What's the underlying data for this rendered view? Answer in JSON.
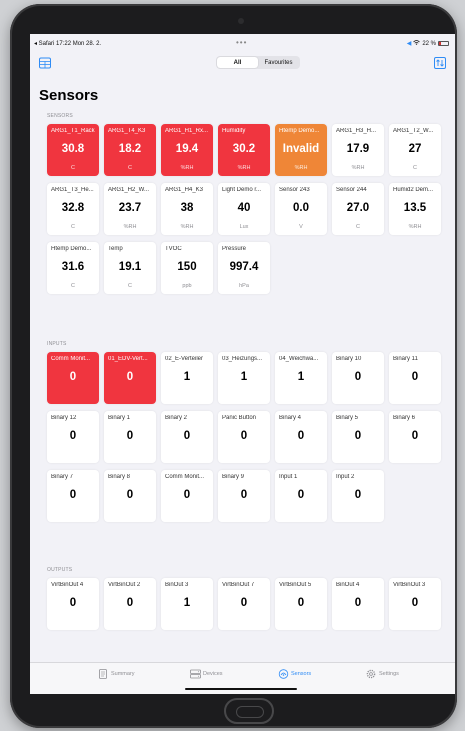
{
  "statusbar": {
    "carrier": "◂ Safari",
    "time": "17:22",
    "date": "Mon 28. 2.",
    "signal": "◀",
    "battery_percent": "22 %",
    "battery_level": 0.22,
    "battery_color": "#d33333"
  },
  "navbar": {
    "segments": [
      {
        "label": "All",
        "active": true
      },
      {
        "label": "Favourites",
        "active": false
      }
    ],
    "left_icon": "grid-icon",
    "right_icon": "sort-icon"
  },
  "page": {
    "title": "Sensors"
  },
  "colors": {
    "alarm": "#f0353f",
    "warning": "#ef8637",
    "accent": "#2f8cf5"
  },
  "sections": {
    "sensors": {
      "label": "SENSORS",
      "tiles": [
        {
          "name": "ARG1_T1_Rack",
          "value": "30.8",
          "unit": "C",
          "state": "red"
        },
        {
          "name": "ARG1_T4_K3",
          "value": "18.2",
          "unit": "C",
          "state": "red"
        },
        {
          "name": "ARG1_H1_Rx...",
          "value": "19.4",
          "unit": "%RH",
          "state": "red"
        },
        {
          "name": "Humidity",
          "value": "30.2",
          "unit": "%RH",
          "state": "red"
        },
        {
          "name": "Htemp Demo...",
          "value": "Invalid",
          "unit": "%RH",
          "state": "orange"
        },
        {
          "name": "ARG1_H3_H...",
          "value": "17.9",
          "unit": "%RH",
          "state": "normal"
        },
        {
          "name": "ARG1_T2_W...",
          "value": "27",
          "unit": "C",
          "state": "normal"
        },
        {
          "name": "ARG1_T3_He...",
          "value": "32.8",
          "unit": "C",
          "state": "normal"
        },
        {
          "name": "ARG1_H2_W...",
          "value": "23.7",
          "unit": "%RH",
          "state": "normal"
        },
        {
          "name": "ARG1_H4_K3",
          "value": "38",
          "unit": "%RH",
          "state": "normal"
        },
        {
          "name": "Light Demo r...",
          "value": "40",
          "unit": "Lux",
          "state": "normal"
        },
        {
          "name": "Sensor 243",
          "value": "0.0",
          "unit": "V",
          "state": "normal"
        },
        {
          "name": "Sensor 244",
          "value": "27.0",
          "unit": "C",
          "state": "normal"
        },
        {
          "name": "Humid2 Dem...",
          "value": "13.5",
          "unit": "%RH",
          "state": "normal"
        },
        {
          "name": "Htemp Demo...",
          "value": "31.6",
          "unit": "C",
          "state": "normal"
        },
        {
          "name": "Temp",
          "value": "19.1",
          "unit": "C",
          "state": "normal"
        },
        {
          "name": "TVOC",
          "value": "150",
          "unit": "ppb",
          "state": "normal"
        },
        {
          "name": "Pressure",
          "value": "997.4",
          "unit": "hPa",
          "state": "normal"
        }
      ]
    },
    "inputs": {
      "label": "INPUTS",
      "tiles": [
        {
          "name": "Comm Monit...",
          "value": "0",
          "unit": "",
          "state": "red"
        },
        {
          "name": "01_EDV-Vert...",
          "value": "0",
          "unit": "",
          "state": "red"
        },
        {
          "name": "02_E-Verteiler",
          "value": "1",
          "unit": "",
          "state": "normal"
        },
        {
          "name": "03_Heizungs...",
          "value": "1",
          "unit": "",
          "state": "normal"
        },
        {
          "name": "04_Weichwa...",
          "value": "1",
          "unit": "",
          "state": "normal"
        },
        {
          "name": "Binary 10",
          "value": "0",
          "unit": "",
          "state": "normal"
        },
        {
          "name": "Binary 11",
          "value": "0",
          "unit": "",
          "state": "normal"
        },
        {
          "name": "Binary 12",
          "value": "0",
          "unit": "",
          "state": "normal"
        },
        {
          "name": "Binary 1",
          "value": "0",
          "unit": "",
          "state": "normal"
        },
        {
          "name": "Binary 2",
          "value": "0",
          "unit": "",
          "state": "normal"
        },
        {
          "name": "Panic Button",
          "value": "0",
          "unit": "",
          "state": "normal"
        },
        {
          "name": "Binary 4",
          "value": "0",
          "unit": "",
          "state": "normal"
        },
        {
          "name": "Binary 5",
          "value": "0",
          "unit": "",
          "state": "normal"
        },
        {
          "name": "Binary 6",
          "value": "0",
          "unit": "",
          "state": "normal"
        },
        {
          "name": "Binary 7",
          "value": "0",
          "unit": "",
          "state": "normal"
        },
        {
          "name": "Binary 8",
          "value": "0",
          "unit": "",
          "state": "normal"
        },
        {
          "name": "Comm Monit...",
          "value": "0",
          "unit": "",
          "state": "normal"
        },
        {
          "name": "Binary 9",
          "value": "0",
          "unit": "",
          "state": "normal"
        },
        {
          "name": "Input 1",
          "value": "0",
          "unit": "",
          "state": "normal"
        },
        {
          "name": "Input 2",
          "value": "0",
          "unit": "",
          "state": "normal"
        }
      ]
    },
    "outputs": {
      "label": "OUTPUTS",
      "tiles": [
        {
          "name": "VirtBinOut 4",
          "value": "0",
          "unit": "",
          "state": "normal"
        },
        {
          "name": "VirtBinOut 2",
          "value": "0",
          "unit": "",
          "state": "normal"
        },
        {
          "name": "BinOut 3",
          "value": "1",
          "unit": "",
          "state": "normal"
        },
        {
          "name": "VirtBinOut 7",
          "value": "0",
          "unit": "",
          "state": "normal"
        },
        {
          "name": "VirtBinOut 5",
          "value": "0",
          "unit": "",
          "state": "normal"
        },
        {
          "name": "BinOut 4",
          "value": "0",
          "unit": "",
          "state": "normal"
        },
        {
          "name": "VirtBinOut 3",
          "value": "0",
          "unit": "",
          "state": "normal"
        }
      ]
    }
  },
  "tabbar": {
    "items": [
      {
        "label": "Summary",
        "icon": "document-icon",
        "active": false
      },
      {
        "label": "Devices",
        "icon": "server-icon",
        "active": false
      },
      {
        "label": "Sensors",
        "icon": "sensor-icon",
        "active": true
      },
      {
        "label": "Settings",
        "icon": "gear-icon",
        "active": false
      }
    ]
  }
}
